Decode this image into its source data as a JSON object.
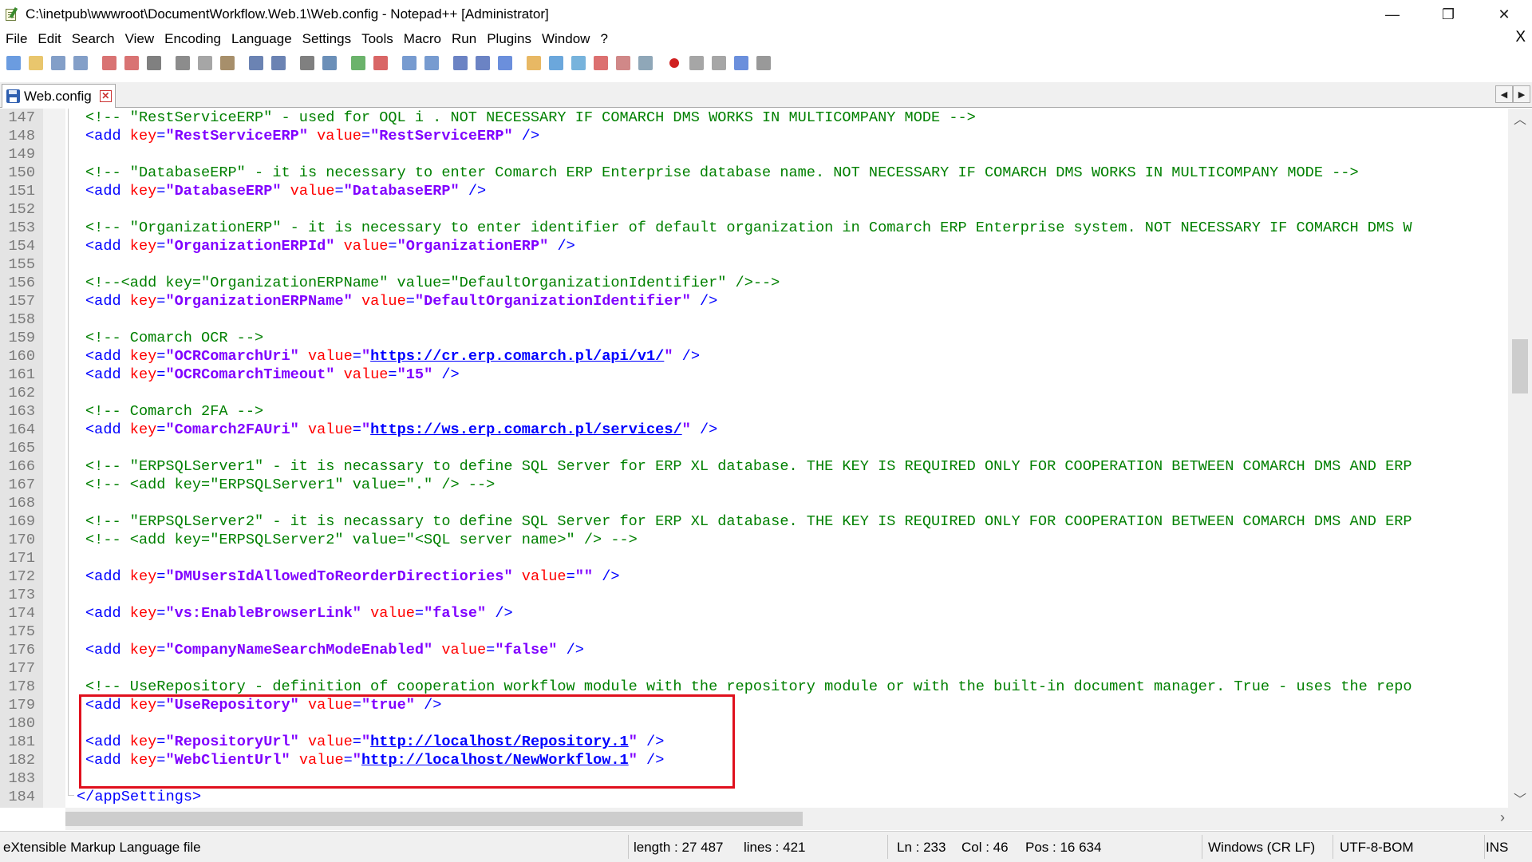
{
  "window": {
    "title": "C:\\inetpub\\wwwroot\\DocumentWorkflow.Web.1\\Web.config - Notepad++ [Administrator]",
    "minimize": "—",
    "restore": "❐",
    "close": "✕"
  },
  "menu": {
    "items": [
      "File",
      "Edit",
      "Search",
      "View",
      "Encoding",
      "Language",
      "Settings",
      "Tools",
      "Macro",
      "Run",
      "Plugins",
      "Window",
      "?"
    ],
    "close": "X"
  },
  "toolbar": {
    "icons": [
      "new-file-icon",
      "open-file-icon",
      "save-icon",
      "save-all-icon",
      "close-icon",
      "close-all-icon",
      "print-icon",
      "cut-icon",
      "copy-icon",
      "paste-icon",
      "undo-icon",
      "redo-icon",
      "find-icon",
      "replace-icon",
      "zoom-in-icon",
      "zoom-out-icon",
      "sync-vertical-icon",
      "sync-horizontal-icon",
      "word-wrap-icon",
      "show-all-chars-icon",
      "indent-guide-icon",
      "udl-icon",
      "doc-map-icon",
      "function-list-icon",
      "folder-workspace-icon",
      "doc-list-icon",
      "monitoring-icon",
      "record-macro-icon",
      "stop-record-icon",
      "play-macro-icon",
      "run-macro-multiple-icon",
      "save-macro-icon"
    ]
  },
  "tabs": [
    {
      "label": "Web.config",
      "close": "✕"
    }
  ],
  "tab_nav": {
    "left": "◀",
    "right": "▶"
  },
  "editor": {
    "lines": [
      {
        "n": "147",
        "parts": [
          [
            "c-comment",
            "<!-- \"RestServiceERP\" - used for OQL i . NOT NECESSARY IF COMARCH DMS WORKS IN MULTICOMPANY MODE -->"
          ]
        ]
      },
      {
        "n": "148",
        "parts": [
          [
            "c-tag",
            "<add "
          ],
          [
            "c-attr",
            "key"
          ],
          [
            "c-sym",
            "="
          ],
          [
            "c-val",
            "\"RestServiceERP\""
          ],
          [
            "c-attr",
            " value"
          ],
          [
            "c-sym",
            "="
          ],
          [
            "c-val",
            "\"RestServiceERP\""
          ],
          [
            "c-tag",
            " />"
          ]
        ]
      },
      {
        "n": "149",
        "parts": []
      },
      {
        "n": "150",
        "parts": [
          [
            "c-comment",
            "<!-- \"DatabaseERP\" - it is necessary to enter Comarch ERP Enterprise database name. NOT NECESSARY IF COMARCH DMS WORKS IN MULTICOMPANY MODE -->"
          ]
        ]
      },
      {
        "n": "151",
        "parts": [
          [
            "c-tag",
            "<add "
          ],
          [
            "c-attr",
            "key"
          ],
          [
            "c-sym",
            "="
          ],
          [
            "c-val",
            "\"DatabaseERP\""
          ],
          [
            "c-attr",
            " value"
          ],
          [
            "c-sym",
            "="
          ],
          [
            "c-val",
            "\"DatabaseERP\""
          ],
          [
            "c-tag",
            " />"
          ]
        ]
      },
      {
        "n": "152",
        "parts": []
      },
      {
        "n": "153",
        "parts": [
          [
            "c-comment",
            "<!-- \"OrganizationERP\" - it is necessary to enter identifier of default organization in Comarch ERP Enterprise system. NOT NECESSARY IF COMARCH DMS W"
          ]
        ]
      },
      {
        "n": "154",
        "parts": [
          [
            "c-tag",
            "<add "
          ],
          [
            "c-attr",
            "key"
          ],
          [
            "c-sym",
            "="
          ],
          [
            "c-val",
            "\"OrganizationERPId\""
          ],
          [
            "c-attr",
            " value"
          ],
          [
            "c-sym",
            "="
          ],
          [
            "c-val",
            "\"OrganizationERP\""
          ],
          [
            "c-tag",
            " />"
          ]
        ]
      },
      {
        "n": "155",
        "parts": []
      },
      {
        "n": "156",
        "parts": [
          [
            "c-comment",
            "<!--<add key=\"OrganizationERPName\" value=\"DefaultOrganizationIdentifier\" />-->"
          ]
        ]
      },
      {
        "n": "157",
        "parts": [
          [
            "c-tag",
            "<add "
          ],
          [
            "c-attr",
            "key"
          ],
          [
            "c-sym",
            "="
          ],
          [
            "c-val",
            "\"OrganizationERPName\""
          ],
          [
            "c-attr",
            " value"
          ],
          [
            "c-sym",
            "="
          ],
          [
            "c-val",
            "\"DefaultOrganizationIdentifier\""
          ],
          [
            "c-tag",
            " />"
          ]
        ]
      },
      {
        "n": "158",
        "parts": []
      },
      {
        "n": "159",
        "parts": [
          [
            "c-comment",
            "<!-- Comarch OCR -->"
          ]
        ]
      },
      {
        "n": "160",
        "parts": [
          [
            "c-tag",
            "<add "
          ],
          [
            "c-attr",
            "key"
          ],
          [
            "c-sym",
            "="
          ],
          [
            "c-val",
            "\"OCRComarchUri\""
          ],
          [
            "c-attr",
            " value"
          ],
          [
            "c-sym",
            "="
          ],
          [
            "c-val",
            "\""
          ],
          [
            "c-val c-link",
            "https://cr.erp.comarch.pl/api/v1/"
          ],
          [
            "c-val",
            "\""
          ],
          [
            "c-tag",
            " />"
          ]
        ]
      },
      {
        "n": "161",
        "parts": [
          [
            "c-tag",
            "<add "
          ],
          [
            "c-attr",
            "key"
          ],
          [
            "c-sym",
            "="
          ],
          [
            "c-val",
            "\"OCRComarchTimeout\""
          ],
          [
            "c-attr",
            " value"
          ],
          [
            "c-sym",
            "="
          ],
          [
            "c-val",
            "\"15\""
          ],
          [
            "c-tag",
            " />"
          ]
        ]
      },
      {
        "n": "162",
        "parts": []
      },
      {
        "n": "163",
        "parts": [
          [
            "c-comment",
            "<!-- Comarch 2FA -->"
          ]
        ]
      },
      {
        "n": "164",
        "parts": [
          [
            "c-tag",
            "<add "
          ],
          [
            "c-attr",
            "key"
          ],
          [
            "c-sym",
            "="
          ],
          [
            "c-val",
            "\"Comarch2FAUri\""
          ],
          [
            "c-attr",
            " value"
          ],
          [
            "c-sym",
            "="
          ],
          [
            "c-val",
            "\""
          ],
          [
            "c-val c-link",
            "https://ws.erp.comarch.pl/services/"
          ],
          [
            "c-val",
            "\""
          ],
          [
            "c-tag",
            " />"
          ]
        ]
      },
      {
        "n": "165",
        "parts": []
      },
      {
        "n": "166",
        "parts": [
          [
            "c-comment",
            "<!-- \"ERPSQLServer1\" - it is necassary to define SQL Server for ERP XL database. THE KEY IS REQUIRED ONLY FOR COOPERATION BETWEEN COMARCH DMS AND ERP"
          ]
        ]
      },
      {
        "n": "167",
        "parts": [
          [
            "c-comment",
            "<!-- <add key=\"ERPSQLServer1\" value=\".\" /> -->"
          ]
        ]
      },
      {
        "n": "168",
        "parts": []
      },
      {
        "n": "169",
        "parts": [
          [
            "c-comment",
            "<!-- \"ERPSQLServer2\" - it is necassary to define SQL Server for ERP XL database. THE KEY IS REQUIRED ONLY FOR COOPERATION BETWEEN COMARCH DMS AND ERP"
          ]
        ]
      },
      {
        "n": "170",
        "parts": [
          [
            "c-comment",
            "<!-- <add key=\"ERPSQLServer2\" value=\"<SQL server name>\" /> -->"
          ]
        ]
      },
      {
        "n": "171",
        "parts": []
      },
      {
        "n": "172",
        "parts": [
          [
            "c-tag",
            "<add "
          ],
          [
            "c-attr",
            "key"
          ],
          [
            "c-sym",
            "="
          ],
          [
            "c-val",
            "\"DMUsersIdAllowedToReorderDirectiories\""
          ],
          [
            "c-attr",
            " value"
          ],
          [
            "c-sym",
            "="
          ],
          [
            "c-val",
            "\"\""
          ],
          [
            "c-tag",
            " />"
          ]
        ]
      },
      {
        "n": "173",
        "parts": []
      },
      {
        "n": "174",
        "parts": [
          [
            "c-tag",
            "<add "
          ],
          [
            "c-attr",
            "key"
          ],
          [
            "c-sym",
            "="
          ],
          [
            "c-val",
            "\"vs:EnableBrowserLink\""
          ],
          [
            "c-attr",
            " value"
          ],
          [
            "c-sym",
            "="
          ],
          [
            "c-val",
            "\"false\""
          ],
          [
            "c-tag",
            " />"
          ]
        ]
      },
      {
        "n": "175",
        "parts": []
      },
      {
        "n": "176",
        "parts": [
          [
            "c-tag",
            "<add "
          ],
          [
            "c-attr",
            "key"
          ],
          [
            "c-sym",
            "="
          ],
          [
            "c-val",
            "\"CompanyNameSearchModeEnabled\""
          ],
          [
            "c-attr",
            " value"
          ],
          [
            "c-sym",
            "="
          ],
          [
            "c-val",
            "\"false\""
          ],
          [
            "c-tag",
            " />"
          ]
        ]
      },
      {
        "n": "177",
        "parts": []
      },
      {
        "n": "178",
        "parts": [
          [
            "c-comment",
            "<!-- UseRepository - definition of cooperation workflow module with the repository module or with the built-in document manager. True - uses the repo"
          ]
        ]
      },
      {
        "n": "179",
        "parts": [
          [
            "c-tag",
            "<add "
          ],
          [
            "c-attr",
            "key"
          ],
          [
            "c-sym",
            "="
          ],
          [
            "c-val",
            "\"UseRepository\""
          ],
          [
            "c-attr",
            " value"
          ],
          [
            "c-sym",
            "="
          ],
          [
            "c-val",
            "\"true\""
          ],
          [
            "c-tag",
            " />"
          ]
        ]
      },
      {
        "n": "180",
        "parts": []
      },
      {
        "n": "181",
        "parts": [
          [
            "c-tag",
            "<add "
          ],
          [
            "c-attr",
            "key"
          ],
          [
            "c-sym",
            "="
          ],
          [
            "c-val",
            "\"RepositoryUrl\""
          ],
          [
            "c-attr",
            " value"
          ],
          [
            "c-sym",
            "="
          ],
          [
            "c-val",
            "\""
          ],
          [
            "c-val c-link",
            "http://localhost/Repository.1"
          ],
          [
            "c-val",
            "\""
          ],
          [
            "c-tag",
            " />"
          ]
        ]
      },
      {
        "n": "182",
        "parts": [
          [
            "c-tag",
            "<add "
          ],
          [
            "c-attr",
            "key"
          ],
          [
            "c-sym",
            "="
          ],
          [
            "c-val",
            "\"WebClientUrl\""
          ],
          [
            "c-attr",
            " value"
          ],
          [
            "c-sym",
            "="
          ],
          [
            "c-val",
            "\""
          ],
          [
            "c-val c-link",
            "http://localhost/NewWorkflow.1"
          ],
          [
            "c-val",
            "\""
          ],
          [
            "c-tag",
            " />"
          ]
        ]
      },
      {
        "n": "183",
        "parts": []
      },
      {
        "n": "184",
        "parts": [
          [
            "c-closingtag",
            "</appSettings>"
          ]
        ]
      }
    ]
  },
  "scroll": {
    "up": "︿",
    "down": "﹀",
    "right": "›"
  },
  "status": {
    "file_type": "eXtensible Markup Language file",
    "length": "length : 27 487",
    "lines": "lines : 421",
    "ln": "Ln : 233",
    "col": "Col : 46",
    "pos": "Pos : 16 634",
    "eol": "Windows (CR LF)",
    "encoding": "UTF-8-BOM",
    "mode": "INS"
  }
}
